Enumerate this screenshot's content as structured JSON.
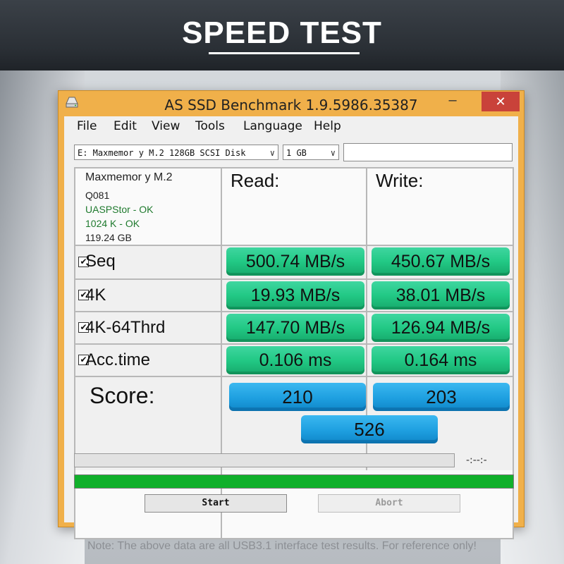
{
  "banner": {
    "title": "SPEED TEST"
  },
  "window": {
    "title": "AS SSD Benchmark 1.9.5986.35387",
    "minimize_label": "–",
    "close_label": "✕"
  },
  "menu": [
    "File",
    "Edit",
    "View",
    "Tools",
    "Language",
    "Help"
  ],
  "toolbar": {
    "drive_select": "E: Maxmemor y M.2 128GB SCSI Disk",
    "size_select": "1 GB",
    "arrow": "∨"
  },
  "device": {
    "name": "Maxmemor y M.2",
    "firmware": "Q081",
    "driver_status": "UASPStor - OK",
    "alignment_status": "1024 K - OK",
    "capacity": "119.24 GB"
  },
  "headers": {
    "read": "Read:",
    "write": "Write:"
  },
  "rows": [
    {
      "label": "Seq",
      "checked": "✔",
      "read": "500.74 MB/s",
      "write": "450.67 MB/s"
    },
    {
      "label": "4K",
      "checked": "✔",
      "read": "19.93 MB/s",
      "write": "38.01 MB/s"
    },
    {
      "label": "4K-64Thrd",
      "checked": "✔",
      "read": "147.70 MB/s",
      "write": "126.94 MB/s"
    },
    {
      "label": "Acc.time",
      "checked": "✔",
      "read": "0.106 ms",
      "write": "0.164 ms"
    }
  ],
  "score": {
    "label": "Score:",
    "read": "210",
    "write": "203",
    "total": "526"
  },
  "status": {
    "time": "-:--:-",
    "progress_fraction": 1.0
  },
  "buttons": {
    "start": "Start",
    "abort": "Abort"
  },
  "colors": {
    "result_green": "#22c985",
    "score_blue": "#1e9fe0",
    "progress_green": "#11b02b",
    "title_bar": "#f0b04a",
    "close_red": "#c9423a",
    "status_green": "#1f7a2e"
  },
  "footer": {
    "note": "Note: The above data are all USB3.1 interface test results. For reference only!"
  }
}
